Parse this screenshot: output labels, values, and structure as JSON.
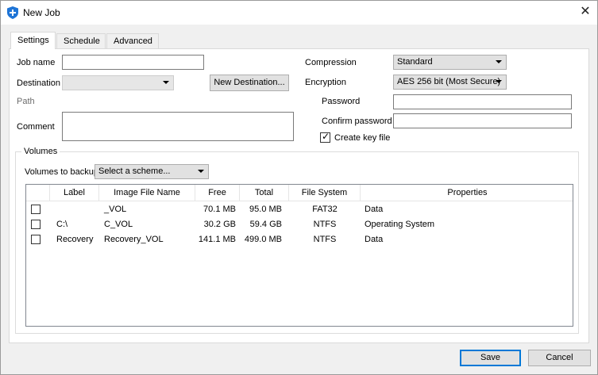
{
  "window": {
    "title": "New Job",
    "close_glyph": "✕",
    "icon": "shield-icon"
  },
  "tabs": [
    {
      "label": "Settings",
      "active": true
    },
    {
      "label": "Schedule",
      "active": false
    },
    {
      "label": "Advanced",
      "active": false
    }
  ],
  "settings": {
    "job_name": {
      "label": "Job name",
      "value": ""
    },
    "destination": {
      "label": "Destination",
      "value": ""
    },
    "new_destination_label": "New Destination...",
    "path": {
      "label": "Path",
      "value": ""
    },
    "comment": {
      "label": "Comment",
      "value": ""
    },
    "compression": {
      "label": "Compression",
      "value": "Standard"
    },
    "encryption": {
      "label": "Encryption",
      "value": "AES 256 bit (Most Secure)"
    },
    "password": {
      "label": "Password",
      "value": ""
    },
    "confirm_password": {
      "label": "Confirm password",
      "value": ""
    },
    "create_key_file": {
      "label": "Create key file",
      "checked": true,
      "mark": "✓"
    }
  },
  "volumes": {
    "group_label": "Volumes",
    "backup_label": "Volumes to backup",
    "scheme_value": "Select a scheme...",
    "columns": [
      "Label",
      "Image File Name",
      "Free",
      "Total",
      "File System",
      "Properties"
    ],
    "rows": [
      {
        "checked": false,
        "label": "",
        "image": "_VOL",
        "free": "70.1 MB",
        "total": "95.0 MB",
        "fs": "FAT32",
        "props": "Data"
      },
      {
        "checked": false,
        "label": "C:\\",
        "image": "C_VOL",
        "free": "30.2 GB",
        "total": "59.4 GB",
        "fs": "NTFS",
        "props": "Operating System"
      },
      {
        "checked": false,
        "label": "Recovery",
        "image": "Recovery_VOL",
        "free": "141.1 MB",
        "total": "499.0 MB",
        "fs": "NTFS",
        "props": "Data"
      }
    ]
  },
  "footer": {
    "save_label": "Save",
    "cancel_label": "Cancel"
  },
  "colors": {
    "accent": "#0078d7",
    "icon_blue": "#1e74d6"
  }
}
